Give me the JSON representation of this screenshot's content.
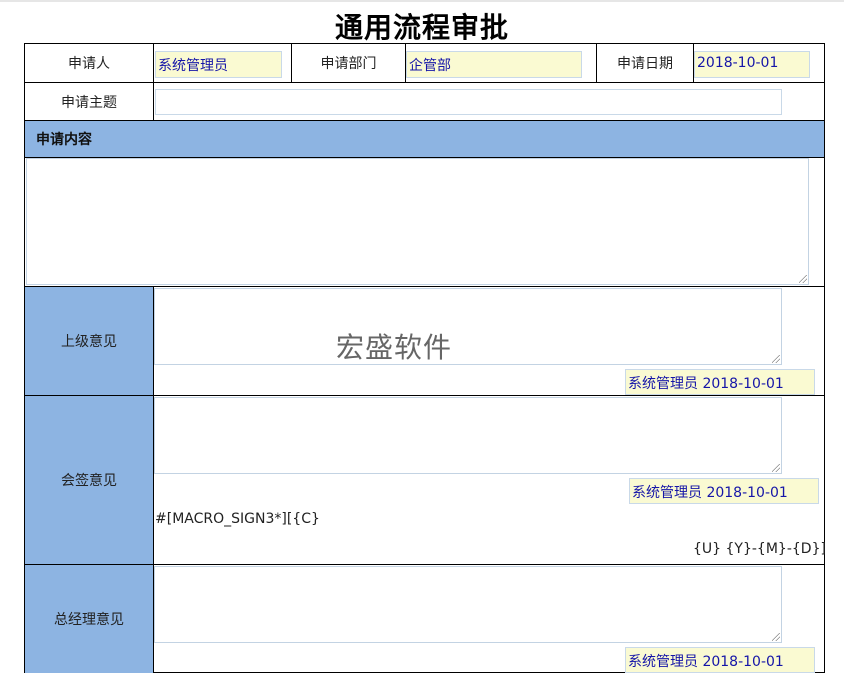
{
  "title": "通用流程审批",
  "row1": {
    "applicant_label": "申请人",
    "applicant_value": "系统管理员",
    "dept_label": "申请部门",
    "dept_value": "企管部",
    "date_label": "申请日期",
    "date_value": "2018-10-01"
  },
  "row2": {
    "subject_label": "申请主题",
    "subject_value": ""
  },
  "content": {
    "section_label": "申请内容",
    "value": ""
  },
  "superior": {
    "label": "上级意见",
    "opinion": "",
    "signature": "系统管理员 2018-10-01"
  },
  "countersign": {
    "label": "会签意见",
    "opinion": "",
    "signature": "系统管理员 2018-10-01",
    "macro": "#[MACRO_SIGN3*][{C}",
    "macro_date": "{U} {Y}-{M}-{D}]"
  },
  "gm": {
    "label": "总经理意见",
    "opinion": "",
    "signature": "系统管理员 2018-10-01"
  },
  "watermark": "宏盛软件"
}
